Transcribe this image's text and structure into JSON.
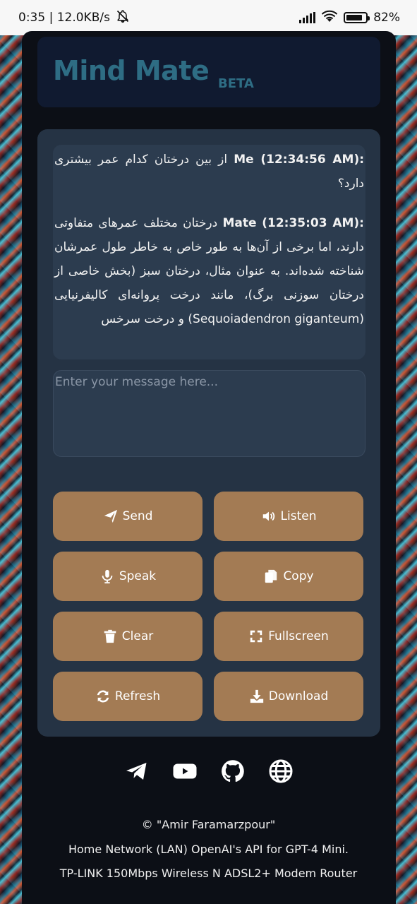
{
  "status_bar": {
    "time_speed": "0:35 | 12.0KB/s",
    "battery": "82%",
    "battery_level": 0.82
  },
  "header": {
    "brand": "Mind Mate",
    "beta": "BETA"
  },
  "chat": {
    "messages": [
      {
        "who": "Me (12:34:56 AM):",
        "text": "از بین درختان کدام عمر بیشتری دارد؟"
      },
      {
        "who": "Mate (12:35:03 AM):",
        "text": "درختان مختلف عمرهای متفاوتی دارند، اما برخی از آن‌ها به طور خاص به خاطر طول عمرشان شناخته شده‌اند. به عنوان مثال، درختان سبز (بخش خاصی از درختان سوزنی برگ)، مانند درخت پروانه‌ای کالیفرنیایی (Sequoiadendron giganteum) و درخت سرخس"
      }
    ]
  },
  "input": {
    "placeholder": "Enter your message here..."
  },
  "buttons": {
    "send": "Send",
    "listen": "Listen",
    "speak": "Speak",
    "copy": "Copy",
    "clear": "Clear",
    "fullscreen": "Fullscreen",
    "refresh": "Refresh",
    "download": "Download"
  },
  "social": [
    "telegram-icon",
    "youtube-icon",
    "github-icon",
    "globe-icon"
  ],
  "footer": {
    "copyright": "© \"Amir Faramarzpour\"",
    "line2": "Home Network (LAN) OpenAI's API for GPT-4 Mini.",
    "line3": "TP-LINK 150Mbps Wireless N ADSL2+ Modem Router"
  },
  "colors": {
    "button": "#a37b54",
    "panel": "#253344",
    "brand": "#2e6d84"
  }
}
